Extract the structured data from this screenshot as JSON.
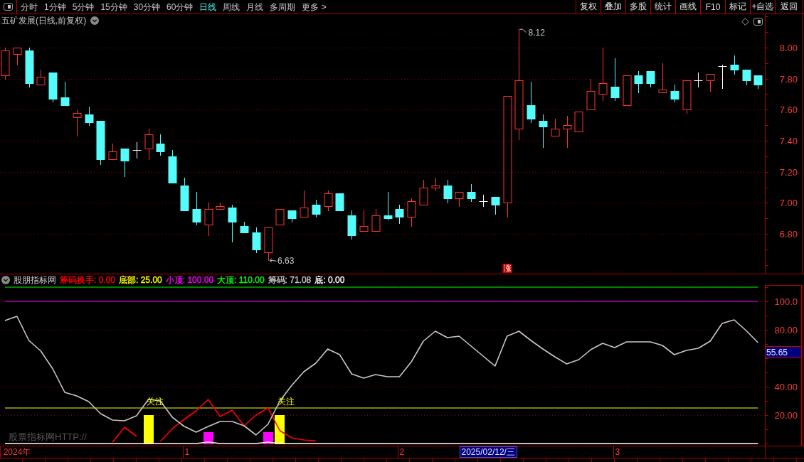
{
  "toolbar": {
    "periods": [
      {
        "label": "分时",
        "selected": false
      },
      {
        "label": "1分钟",
        "selected": false
      },
      {
        "label": "5分钟",
        "selected": false
      },
      {
        "label": "15分钟",
        "selected": false
      },
      {
        "label": "30分钟",
        "selected": false
      },
      {
        "label": "60分钟",
        "selected": false
      },
      {
        "label": "日线",
        "selected": true
      },
      {
        "label": "周线",
        "selected": false
      },
      {
        "label": "月线",
        "selected": false
      },
      {
        "label": "多周期",
        "selected": false
      },
      {
        "label": "更多 >",
        "selected": false
      }
    ],
    "buttons": [
      "复权",
      "叠加",
      "多股",
      "统计",
      "画线",
      "F10",
      "标记",
      "+自选",
      "返回"
    ]
  },
  "price_chart": {
    "title": "五矿发展(日线,前复权)",
    "chart_data": {
      "type": "candlestick",
      "grid": true,
      "categories": [
        null,
        null,
        null,
        null,
        null,
        null,
        null,
        null,
        null,
        null,
        null,
        null,
        null,
        null,
        null,
        null,
        null,
        null,
        null,
        null,
        null,
        null,
        null,
        null,
        null,
        null,
        null,
        null,
        null,
        null,
        null,
        null,
        null,
        null,
        null,
        null,
        null,
        null,
        null,
        null,
        null,
        null,
        null,
        null,
        null,
        null,
        null,
        null,
        null,
        null,
        null,
        null,
        null,
        null,
        null,
        null,
        null,
        null,
        null,
        null,
        null,
        null,
        null,
        null
      ],
      "ylim": [
        6.544,
        8.215
      ],
      "yticks": [
        {
          "value": 8,
          "label": "8.00"
        },
        {
          "value": 7.8,
          "label": "7.80"
        },
        {
          "value": 7.6,
          "label": "7.60"
        },
        {
          "value": 7.4,
          "label": "7.40"
        },
        {
          "value": 7.2,
          "label": "7.20"
        },
        {
          "value": 7,
          "label": "7.00"
        },
        {
          "value": 6.8,
          "label": "6.80"
        }
      ],
      "ohlc": [
        [
          7.82,
          8.0,
          7.8,
          7.98
        ],
        [
          7.96,
          8.0,
          7.89,
          8.0
        ],
        [
          7.98,
          8.0,
          7.75,
          7.77
        ],
        [
          7.76,
          7.86,
          7.76,
          7.81
        ],
        [
          7.84,
          7.84,
          7.65,
          7.67
        ],
        [
          7.68,
          7.78,
          7.63,
          7.63
        ],
        [
          7.55,
          7.6,
          7.43,
          7.58
        ],
        [
          7.57,
          7.62,
          7.5,
          7.52
        ],
        [
          7.53,
          7.53,
          7.25,
          7.28
        ],
        [
          7.28,
          7.38,
          7.28,
          7.33
        ],
        [
          7.35,
          7.35,
          7.17,
          7.27
        ],
        [
          7.34,
          7.39,
          7.29,
          7.34
        ],
        [
          7.35,
          7.48,
          7.28,
          7.44
        ],
        [
          7.38,
          7.44,
          7.31,
          7.33
        ],
        [
          7.3,
          7.34,
          7.13,
          7.13
        ],
        [
          7.11,
          7.16,
          6.95,
          6.95
        ],
        [
          6.96,
          7.07,
          6.86,
          6.88
        ],
        [
          6.86,
          7.0,
          6.79,
          6.96
        ],
        [
          6.96,
          7.0,
          6.96,
          6.98
        ],
        [
          6.97,
          6.99,
          6.75,
          6.88
        ],
        [
          6.85,
          6.88,
          6.81,
          6.81
        ],
        [
          6.81,
          6.84,
          6.68,
          6.7
        ],
        [
          6.68,
          6.84,
          6.63,
          6.84
        ],
        [
          6.86,
          6.96,
          6.86,
          6.96
        ],
        [
          6.95,
          6.95,
          6.88,
          6.9
        ],
        [
          6.91,
          7.08,
          6.91,
          6.97
        ],
        [
          6.99,
          7.02,
          6.91,
          6.93
        ],
        [
          6.98,
          7.08,
          6.95,
          7.06
        ],
        [
          7.06,
          7.06,
          6.95,
          6.95
        ],
        [
          6.92,
          6.95,
          6.77,
          6.79
        ],
        [
          6.82,
          6.95,
          6.82,
          6.85
        ],
        [
          6.82,
          6.96,
          6.82,
          6.92
        ],
        [
          6.92,
          7.07,
          6.89,
          6.9
        ],
        [
          6.96,
          6.99,
          6.87,
          6.91
        ],
        [
          6.91,
          7.03,
          6.85,
          7.01
        ],
        [
          6.99,
          7.15,
          6.99,
          7.1
        ],
        [
          7.1,
          7.16,
          7.08,
          7.11
        ],
        [
          7.11,
          7.15,
          7.0,
          7.03
        ],
        [
          7.03,
          7.07,
          6.98,
          7.07
        ],
        [
          7.07,
          7.12,
          7.01,
          7.03
        ],
        [
          7.01,
          7.05,
          6.98,
          7.01
        ],
        [
          7.04,
          7.04,
          6.93,
          6.99
        ],
        [
          7.0,
          7.69,
          6.91,
          7.69
        ],
        [
          7.48,
          8.12,
          7.41,
          7.79
        ],
        [
          7.63,
          7.78,
          7.52,
          7.54
        ],
        [
          7.53,
          7.57,
          7.36,
          7.49
        ],
        [
          7.43,
          7.54,
          7.43,
          7.48
        ],
        [
          7.48,
          7.56,
          7.36,
          7.5
        ],
        [
          7.46,
          7.59,
          7.46,
          7.59
        ],
        [
          7.6,
          7.8,
          7.6,
          7.72
        ],
        [
          7.7,
          8.0,
          7.66,
          7.77
        ],
        [
          7.75,
          7.93,
          7.66,
          7.68
        ],
        [
          7.63,
          7.82,
          7.63,
          7.82
        ],
        [
          7.82,
          7.85,
          7.71,
          7.77
        ],
        [
          7.85,
          7.85,
          7.75,
          7.77
        ],
        [
          7.71,
          7.9,
          7.71,
          7.73
        ],
        [
          7.72,
          7.76,
          7.65,
          7.67
        ],
        [
          7.6,
          7.79,
          7.58,
          7.79
        ],
        [
          7.79,
          7.84,
          7.75,
          7.79
        ],
        [
          7.79,
          7.83,
          7.72,
          7.83
        ],
        [
          7.88,
          7.89,
          7.74,
          7.88
        ],
        [
          7.89,
          7.95,
          7.83,
          7.86
        ],
        [
          7.86,
          7.86,
          7.76,
          7.79
        ],
        [
          7.82,
          7.82,
          7.74,
          7.76
        ]
      ],
      "annotations": [
        "8.12",
        "6.63",
        "涨"
      ]
    }
  },
  "indicator": {
    "name": "股朋指标网",
    "legend": [
      {
        "text": "筹码换手: 0.00",
        "color": "#ff0000"
      },
      {
        "text": "底部: 25.00",
        "color": "#ffff00"
      },
      {
        "text": "小顶: 100.00",
        "color": "#ff00ff"
      },
      {
        "text": "大顶: 110.00",
        "color": "#00ff00"
      },
      {
        "text": "筹码: 71.08",
        "color": "#c8c8c8"
      },
      {
        "text": "底: 0.00",
        "color": "#ffffff"
      }
    ],
    "note": "股票指标网HTTP://",
    "cursor": {
      "date": "2025/02/12/三",
      "value": "55.65"
    },
    "chart_data": {
      "type": "line",
      "grid": true,
      "categories": [
        null,
        "2024年",
        null,
        null,
        null,
        null,
        null,
        null,
        null,
        null,
        null,
        null,
        null,
        null,
        null,
        "1",
        null,
        null,
        null,
        null,
        null,
        null,
        null,
        null,
        null,
        null,
        null,
        null,
        null,
        null,
        null,
        null,
        null,
        "2",
        null,
        null,
        null,
        null,
        null,
        null,
        null,
        null,
        null,
        null,
        null,
        null,
        null,
        null,
        null,
        null,
        null,
        "3",
        null,
        null,
        null,
        null,
        null,
        null,
        null,
        null,
        null,
        null,
        null,
        null
      ],
      "ylim": [
        -1.5,
        111.5
      ],
      "yticks": [
        {
          "value": 100,
          "label": "100.0"
        },
        {
          "value": 80,
          "label": "80.00"
        },
        {
          "value": 40,
          "label": "40.00"
        },
        {
          "value": 20,
          "label": "20.00"
        }
      ],
      "series": [
        {
          "color": "#00ff00",
          "values": [
            110,
            110,
            110,
            110,
            110,
            110,
            110,
            110,
            110,
            110,
            110,
            110,
            110,
            110,
            110,
            110,
            110,
            110,
            110,
            110,
            110,
            110,
            110,
            110,
            110,
            110,
            110,
            110,
            110,
            110,
            110,
            110,
            110,
            110,
            110,
            110,
            110,
            110,
            110,
            110,
            110,
            110,
            110,
            110,
            110,
            110,
            110,
            110,
            110,
            110,
            110,
            110,
            110,
            110,
            110,
            110,
            110,
            110,
            110,
            110,
            110,
            110,
            110,
            110
          ]
        },
        {
          "color": "#ff00ff",
          "values": [
            100,
            100,
            100,
            100,
            100,
            100,
            100,
            100,
            100,
            100,
            100,
            100,
            100,
            100,
            100,
            100,
            100,
            100,
            100,
            100,
            100,
            100,
            100,
            100,
            100,
            100,
            100,
            100,
            100,
            100,
            100,
            100,
            100,
            100,
            100,
            100,
            100,
            100,
            100,
            100,
            100,
            100,
            100,
            100,
            100,
            100,
            100,
            100,
            100,
            100,
            100,
            100,
            100,
            100,
            100,
            100,
            100,
            100,
            100,
            100,
            100,
            100,
            100,
            100
          ]
        },
        {
          "color": "#ffff00",
          "values": [
            25,
            25,
            25,
            25,
            25,
            25,
            25,
            25,
            25,
            25,
            25,
            25,
            25,
            25,
            25,
            25,
            25,
            25,
            25,
            25,
            25,
            25,
            25,
            25,
            25,
            25,
            25,
            25,
            25,
            25,
            25,
            25,
            25,
            25,
            25,
            25,
            25,
            25,
            25,
            25,
            25,
            25,
            25,
            25,
            25,
            25,
            25,
            25,
            25,
            25,
            25,
            25,
            25,
            25,
            25,
            25,
            25,
            25,
            25,
            25,
            25,
            25,
            25,
            25
          ]
        },
        {
          "color": "#ff0000",
          "values": [
            null,
            null,
            null,
            null,
            null,
            null,
            null,
            null,
            null,
            1,
            11.5,
            5,
            null,
            1.5,
            10.5,
            17,
            23,
            31,
            19,
            23.5,
            12.5,
            20,
            25,
            9,
            4,
            2.5,
            1.8,
            null,
            null,
            null,
            null,
            null,
            null,
            null,
            null,
            null,
            null,
            null,
            null,
            null,
            null,
            null,
            null,
            null,
            null,
            null,
            null,
            null,
            null,
            null,
            null,
            null,
            null,
            null,
            null,
            null,
            null,
            null,
            null,
            null,
            null,
            null,
            null,
            null
          ]
        },
        {
          "type": "bar",
          "color": "#ffff00",
          "values": [
            null,
            null,
            null,
            null,
            null,
            null,
            null,
            null,
            null,
            null,
            null,
            null,
            20,
            null,
            null,
            null,
            null,
            null,
            null,
            null,
            null,
            null,
            null,
            20,
            null,
            null,
            null,
            null,
            null,
            null,
            null,
            null,
            null,
            null,
            null,
            null,
            null,
            null,
            null,
            null,
            null,
            null,
            null,
            null,
            null,
            null,
            null,
            null,
            null,
            null,
            null,
            null,
            null,
            null,
            null,
            null,
            null,
            null,
            null,
            null,
            null,
            null,
            null,
            null
          ]
        },
        {
          "type": "bar",
          "color": "#ff00ff",
          "values": [
            null,
            null,
            null,
            null,
            null,
            null,
            null,
            null,
            null,
            null,
            null,
            null,
            null,
            null,
            null,
            null,
            null,
            8,
            null,
            null,
            null,
            null,
            8,
            null,
            null,
            null,
            null,
            null,
            null,
            null,
            null,
            null,
            null,
            null,
            null,
            null,
            null,
            null,
            null,
            null,
            null,
            null,
            null,
            null,
            null,
            null,
            null,
            null,
            null,
            null,
            null,
            null,
            null,
            null,
            null,
            null,
            null,
            null,
            null,
            null,
            null,
            null,
            null,
            null
          ]
        },
        {
          "color": "#ffffff",
          "values": [
            0,
            0,
            0,
            0,
            0,
            0,
            0,
            0,
            0,
            0,
            0,
            0,
            0,
            0,
            0,
            0,
            0,
            1,
            0,
            0,
            0,
            0,
            1,
            0,
            0,
            0,
            0,
            0,
            0,
            0,
            0,
            0,
            0,
            0,
            0,
            0,
            0,
            0,
            0,
            0,
            0,
            0,
            0,
            0,
            0,
            0,
            0,
            0,
            0,
            0,
            0,
            0,
            0,
            0,
            0,
            0,
            0,
            0,
            0,
            0,
            0,
            0,
            0,
            0
          ]
        },
        {
          "color": "#c8c8c8",
          "values": [
            86.5,
            89.5,
            72.5,
            65,
            52.5,
            36,
            33.5,
            29.5,
            21,
            16.5,
            16,
            19.5,
            31,
            30,
            18.5,
            12,
            8,
            12,
            15.5,
            15.5,
            12.5,
            6,
            13.5,
            30,
            41,
            50.5,
            56.5,
            66.5,
            62.5,
            49,
            46,
            48.5,
            47,
            47,
            57.5,
            72,
            79,
            74.5,
            75.5,
            68.5,
            61.5,
            54.5,
            75.5,
            79,
            72.5,
            66.5,
            61,
            56,
            59,
            66,
            70.5,
            67.5,
            71.5,
            71.5,
            71.5,
            69,
            62.5,
            65.5,
            67,
            72,
            84.5,
            87,
            79.5,
            71
          ]
        }
      ],
      "annotations": [
        {
          "text": "关注",
          "y": 20
        },
        {
          "text": "关注",
          "y": 20
        }
      ]
    }
  }
}
